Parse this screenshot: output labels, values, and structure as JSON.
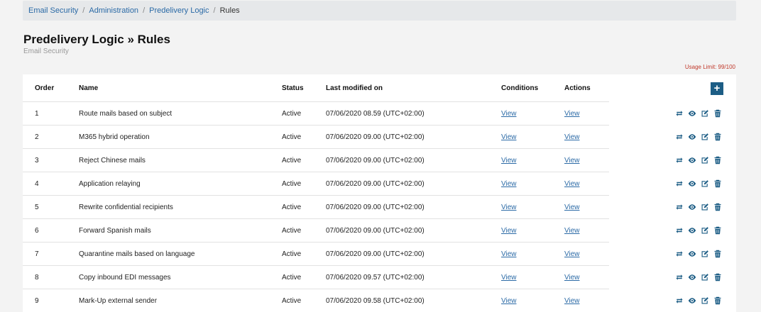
{
  "breadcrumb": [
    {
      "label": "Email Security"
    },
    {
      "label": "Administration"
    },
    {
      "label": "Predelivery Logic"
    },
    {
      "label": "Rules",
      "current": true
    }
  ],
  "page": {
    "title": "Predelivery Logic » Rules",
    "subtitle": "Email Security",
    "usage": "Usage Limit: 99/100"
  },
  "table": {
    "headers": {
      "order": "Order",
      "name": "Name",
      "status": "Status",
      "modified": "Last modified on",
      "conditions": "Conditions",
      "actions": "Actions"
    },
    "add_label": "+",
    "rows": [
      {
        "order": "1",
        "name": "Route mails based on subject",
        "status": "Active",
        "modified": "07/06/2020 08.59 (UTC+02:00)",
        "conditions": "View",
        "actions": "View"
      },
      {
        "order": "2",
        "name": "M365 hybrid operation",
        "status": "Active",
        "modified": "07/06/2020 09.00 (UTC+02:00)",
        "conditions": "View",
        "actions": "View"
      },
      {
        "order": "3",
        "name": "Reject Chinese mails",
        "status": "Active",
        "modified": "07/06/2020 09.00 (UTC+02:00)",
        "conditions": "View",
        "actions": "View"
      },
      {
        "order": "4",
        "name": "Application relaying",
        "status": "Active",
        "modified": "07/06/2020 09.00 (UTC+02:00)",
        "conditions": "View",
        "actions": "View"
      },
      {
        "order": "5",
        "name": "Rewrite confidential recipients",
        "status": "Active",
        "modified": "07/06/2020 09.00 (UTC+02:00)",
        "conditions": "View",
        "actions": "View"
      },
      {
        "order": "6",
        "name": "Forward Spanish mails",
        "status": "Active",
        "modified": "07/06/2020 09.00 (UTC+02:00)",
        "conditions": "View",
        "actions": "View"
      },
      {
        "order": "7",
        "name": "Quarantine mails based on language",
        "status": "Active",
        "modified": "07/06/2020 09.00 (UTC+02:00)",
        "conditions": "View",
        "actions": "View"
      },
      {
        "order": "8",
        "name": "Copy inbound EDI messages",
        "status": "Active",
        "modified": "07/06/2020 09.57 (UTC+02:00)",
        "conditions": "View",
        "actions": "View"
      },
      {
        "order": "9",
        "name": "Mark-Up external sender",
        "status": "Active",
        "modified": "07/06/2020 09.58 (UTC+02:00)",
        "conditions": "View",
        "actions": "View"
      }
    ],
    "row_icons": [
      "reorder-icon",
      "eye-icon",
      "edit-icon",
      "trash-icon"
    ]
  },
  "colors": {
    "accent": "#1c5d85",
    "link": "#2b6aa6",
    "warning": "#c0392b"
  }
}
